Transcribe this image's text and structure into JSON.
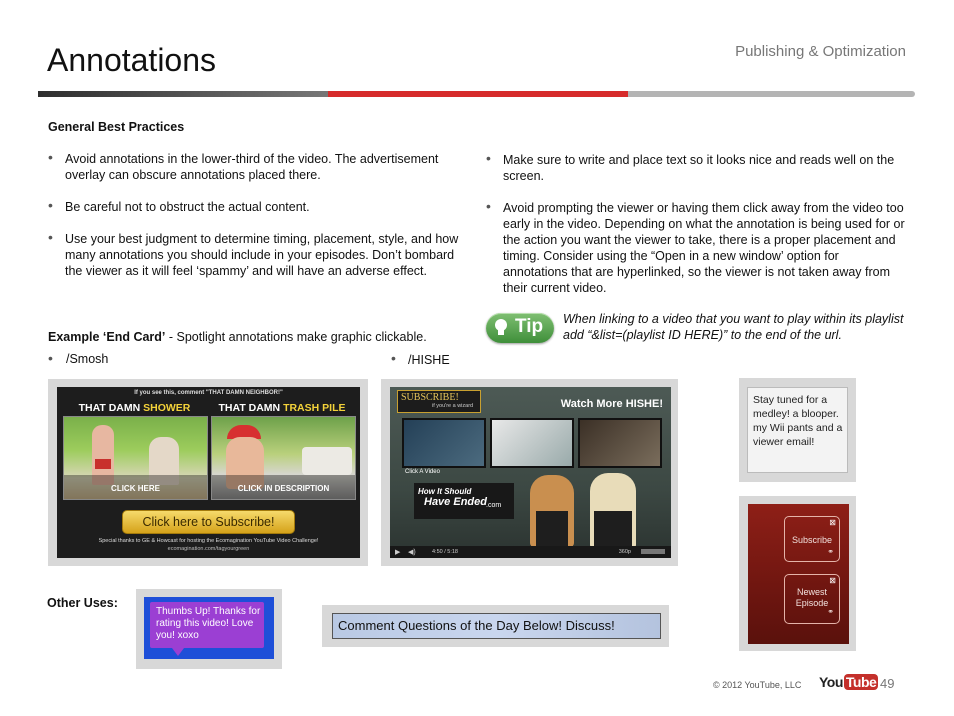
{
  "header": {
    "title": "Annotations",
    "section": "Publishing & Optimization",
    "rule_colors": [
      "#555555",
      "#d62b2b",
      "#b4b4b4"
    ]
  },
  "best_practices": {
    "heading": "General Best Practices",
    "left": [
      "Avoid annotations in the lower-third of the video. The advertisement overlay can obscure annotations placed there.",
      "Be careful not to obstruct the actual content.",
      "Use your best judgment to determine timing, placement, style, and how many annotations you should include in your episodes. Don’t bombard the viewer as it will feel ‘spammy’ and will have an adverse effect."
    ],
    "right": [
      "Make sure to write and place text so it looks nice and reads well on the screen.",
      "Avoid prompting the viewer or having them click away from the video too early in the video. Depending on what the annotation is being used for or the action you want the viewer to take, there is a proper placement and timing. Consider using the “Open in a new window’ option for annotations that are hyperlinked, so the viewer is not taken away from their current video."
    ]
  },
  "tip": {
    "badge": "Tip",
    "text": "When linking to a video that you want to play within its playlist add “&list=(playlist ID HERE)” to the end of the url."
  },
  "example": {
    "label_bold": "Example ‘End Card’",
    "label_rest": " - Spotlight annotations make graphic clickable.",
    "items": [
      "/Smosh",
      "/HISHE"
    ]
  },
  "smosh": {
    "top_text": "If you see this, comment \"THAT DAMN NEIGHBOR!\"",
    "left_title_a": "THAT DAMN ",
    "left_title_b": "SHOWER",
    "right_title_a": "THAT DAMN ",
    "right_title_b": "TRASH PILE",
    "left_caption": "CLICK HERE",
    "right_caption": "CLICK IN DESCRIPTION",
    "subscribe": "Click here to Subscribe!",
    "thanks": "Special thanks to GE & Howcast for hosting the Ecomagination YouTube Video Challenge!",
    "url": "ecomagination.com/tagyourgreen"
  },
  "hishe": {
    "subscribe": "SUBSCRIBE!",
    "wizard": "if you're a wizard",
    "watch_more": "Watch More HISHE!",
    "click_video": "Click A Video",
    "logo_line1": "How It Should",
    "logo_line2": "Have Ended",
    "logo_line3": ".com",
    "time": "4:50 / 5:18",
    "quality": "360p"
  },
  "side_notes": {
    "stay_tuned": "Stay tuned for a medley! a blooper. my Wii pants and a viewer email!",
    "subscribe_label": "Subscribe",
    "newest_label": "Newest Episode"
  },
  "other_uses": {
    "label": "Other Uses:",
    "thumbs": "Thumbs Up! Thanks for rating this video! Love you! xoxo",
    "comment": "Comment Questions of the Day Below! Discuss!"
  },
  "footer": {
    "copyright": "© 2012 YouTube, LLC",
    "logo_you": "You",
    "logo_tube": "Tube",
    "page": "49"
  }
}
